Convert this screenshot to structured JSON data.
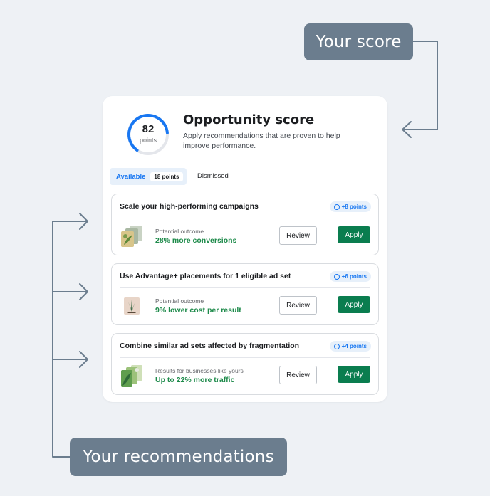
{
  "callouts": {
    "score": "Your score",
    "recommendations": "Your recommendations"
  },
  "score": {
    "value": "82",
    "unit": "points",
    "gauge_fraction": 0.82
  },
  "header": {
    "title": "Opportunity score",
    "subtitle": "Apply recommendations that are proven to help improve performance."
  },
  "tabs": {
    "available_label": "Available",
    "available_badge": "18 points",
    "dismissed_label": "Dismissed"
  },
  "recommendations": [
    {
      "title": "Scale your high-performing campaigns",
      "points": "+8 points",
      "outcome_label": "Potential outcome",
      "outcome_value": "28% more conversions",
      "review_label": "Review",
      "apply_label": "Apply",
      "thumb_icon": "stacked-creatives-icon"
    },
    {
      "title": "Use Advantage+ placements for 1 eligible ad set",
      "points": "+6 points",
      "outcome_label": "Potential outcome",
      "outcome_value": "9% lower cost per result",
      "review_label": "Review",
      "apply_label": "Apply",
      "thumb_icon": "plant-creative-icon"
    },
    {
      "title": "Combine similar ad sets affected by fragmentation",
      "points": "+4 points",
      "outcome_label": "Results for businesses like yours",
      "outcome_value": "Up to 22% more traffic",
      "review_label": "Review",
      "apply_label": "Apply",
      "thumb_icon": "leaf-creatives-icon"
    }
  ],
  "colors": {
    "accent_blue": "#1877f2",
    "gauge_track": "#e4e6eb",
    "success_green": "#1d8a4a",
    "apply_button": "#0a7d4f",
    "callout_bg": "#6b7d8e",
    "connector": "#6b7d8e"
  }
}
